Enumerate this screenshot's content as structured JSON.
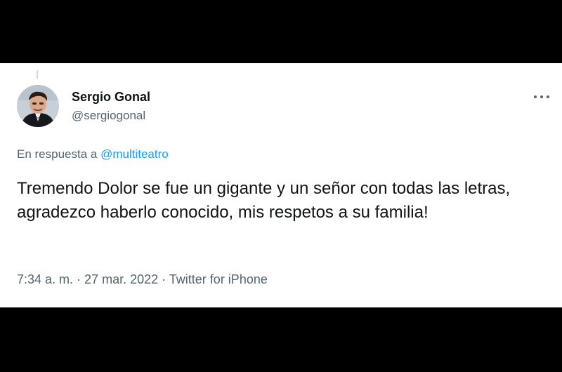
{
  "tweet": {
    "author_name": "Sergio Gonal",
    "author_handle": "@sergiogonal",
    "reply_prefix": "En respuesta a ",
    "reply_mention": "@multiteatro",
    "text": "Tremendo Dolor se fue un gigante y un señor con todas las letras, agradezco haberlo conocido, mis respetos a su familia!",
    "time": "7:34 a. m.",
    "separator": " · ",
    "date": "27 mar. 2022",
    "source": "Twitter for iPhone"
  },
  "colors": {
    "background": "#000000",
    "card": "#ffffff",
    "primary_text": "#0f1419",
    "secondary_text": "#536471",
    "link": "#1d9bf0"
  },
  "icons": {
    "more": "more-horizontal-icon",
    "avatar": "profile-photo"
  }
}
